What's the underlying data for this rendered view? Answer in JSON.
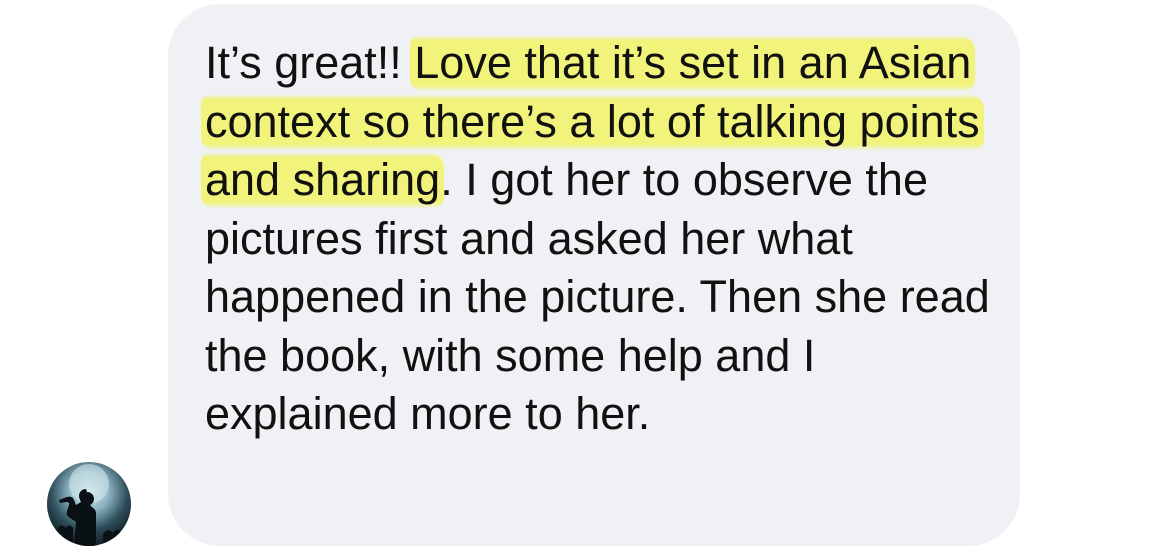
{
  "message": {
    "intro": "It’s great!!",
    "highlighted": "Love that it’s set in an Asian context so there’s a lot of talking points and sharing",
    "rest": ". I got her to observe the pictures first and asked her what happened in the picture. Then she read the book, with some help and I explained more to her."
  },
  "sender": {
    "avatar_icon": "concert-silhouette-avatar"
  },
  "colors": {
    "bubble": "#f0f1f4",
    "highlight": "#f1f370",
    "text": "#111111"
  }
}
